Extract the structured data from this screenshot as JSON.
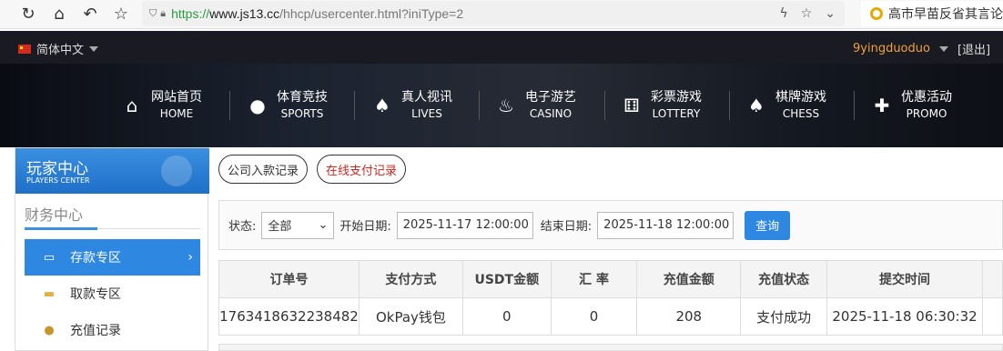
{
  "browser": {
    "url_proto": "https://",
    "url_host": "www.js13.cc",
    "url_path": "/hhcp/usercenter.html?iniType=2",
    "second_tab_title": "高市早苗反省其言论"
  },
  "topbar": {
    "language": "简体中文",
    "username": "9yingduoduo",
    "logout": "[退出]"
  },
  "nav": {
    "items": [
      {
        "cn": "网站首页",
        "en": "HOME",
        "icon": "home-icon"
      },
      {
        "cn": "体育竞技",
        "en": "SPORTS",
        "icon": "basketball-icon"
      },
      {
        "cn": "真人视讯",
        "en": "LIVES",
        "icon": "cards-icon"
      },
      {
        "cn": "电子游艺",
        "en": "CASINO",
        "icon": "slot-icon"
      },
      {
        "cn": "彩票游戏",
        "en": "LOTTERY",
        "icon": "dice-icon"
      },
      {
        "cn": "棋牌游戏",
        "en": "CHESS",
        "icon": "spade-icon"
      },
      {
        "cn": "优惠活动",
        "en": "PROMO",
        "icon": "gift-icon"
      }
    ]
  },
  "sidebar": {
    "title": "玩家中心",
    "subtitle": "PLAYERS CENTER",
    "section": "财务中心",
    "items": [
      {
        "label": "存款专区",
        "icon": "card-icon"
      },
      {
        "label": "取款专区",
        "icon": "cash-icon"
      },
      {
        "label": "充值记录",
        "icon": "moneybag-icon"
      }
    ]
  },
  "main": {
    "tabs": [
      "公司入款记录",
      "在线支付记录"
    ],
    "filter": {
      "status_label": "状态:",
      "status_value": "全部",
      "start_label": "开始日期:",
      "start_value": "2025-11-17 12:00:00",
      "end_label": "结束日期:",
      "end_value": "2025-11-18 12:00:00",
      "query": "查询"
    },
    "table": {
      "headers": [
        "订单号",
        "支付方式",
        "USDT金额",
        "汇 率",
        "充值金额",
        "充值状态",
        "提交时间"
      ],
      "rows": [
        [
          "1763418632238482",
          "OkPay钱包",
          "0",
          "0",
          "208",
          "支付成功",
          "2025-11-18 06:30:32"
        ]
      ]
    }
  },
  "colors": {
    "accent": "#2e87e0",
    "username": "#f0a03c",
    "tab_active_text": "#d9231c"
  }
}
